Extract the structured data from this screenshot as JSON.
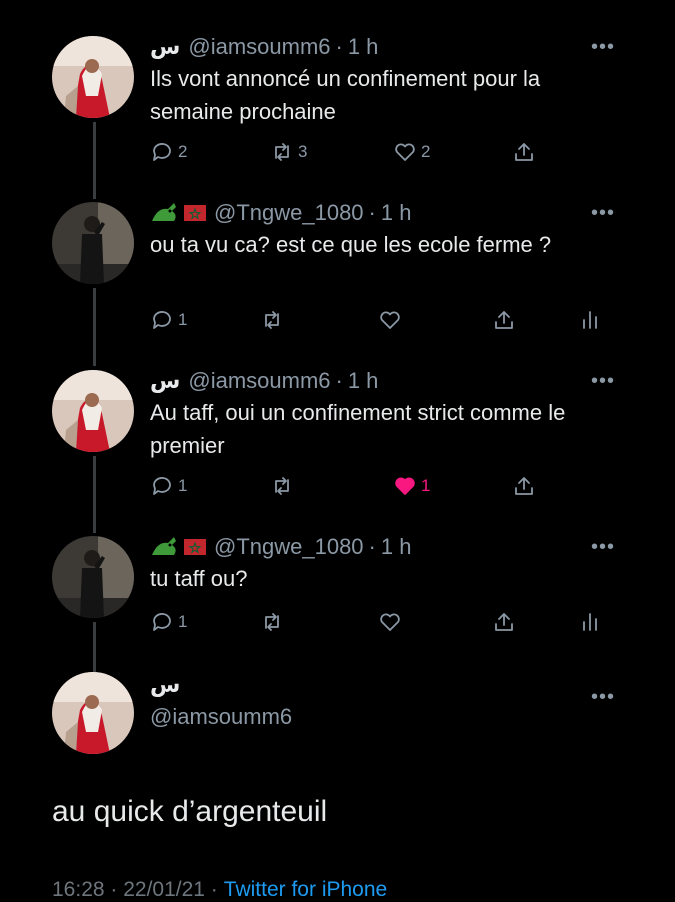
{
  "colors": {
    "background": "#000000",
    "text": "#e7e9ea",
    "secondary": "#8b98a5",
    "accent": "#1d9bf0",
    "like": "#f91880"
  },
  "tweets": [
    {
      "name": "س",
      "handle": "@iamsoumm6",
      "time": "1 h",
      "text": "Ils vont annoncé un confinement pour la semaine prochaine",
      "replies": "2",
      "retweets": "3",
      "likes": "2",
      "avatar": "profile-photo-iamsoumm6"
    },
    {
      "flags": [
        "crocodile-emoji",
        "morocco-flag"
      ],
      "handle": "@Tngwe_1080",
      "time": "1 h",
      "text": "ou ta vu ca? est ce que les ecole ferme ?",
      "replies": "1",
      "retweets": "",
      "likes": "",
      "avatar": "profile-photo-tngwe"
    },
    {
      "name": "س",
      "handle": "@iamsoumm6",
      "time": "1 h",
      "text": "Au taff, oui un confinement strict comme le premier",
      "replies": "1",
      "retweets": "",
      "likes": "1",
      "liked": true,
      "avatar": "profile-photo-iamsoumm6"
    },
    {
      "flags": [
        "crocodile-emoji",
        "morocco-flag"
      ],
      "handle": "@Tngwe_1080",
      "time": "1 h",
      "text": "tu taff ou?",
      "replies": "1",
      "retweets": "",
      "likes": "",
      "avatar": "profile-photo-tngwe"
    }
  ],
  "main_tweet": {
    "name": "س",
    "handle": "@iamsoumm6",
    "text": "au quick d’argenteuil",
    "timestamp": "16:28 · 22/01/21 ·",
    "via": "Twitter for iPhone"
  },
  "separator": "·",
  "more_glyph": "•••"
}
